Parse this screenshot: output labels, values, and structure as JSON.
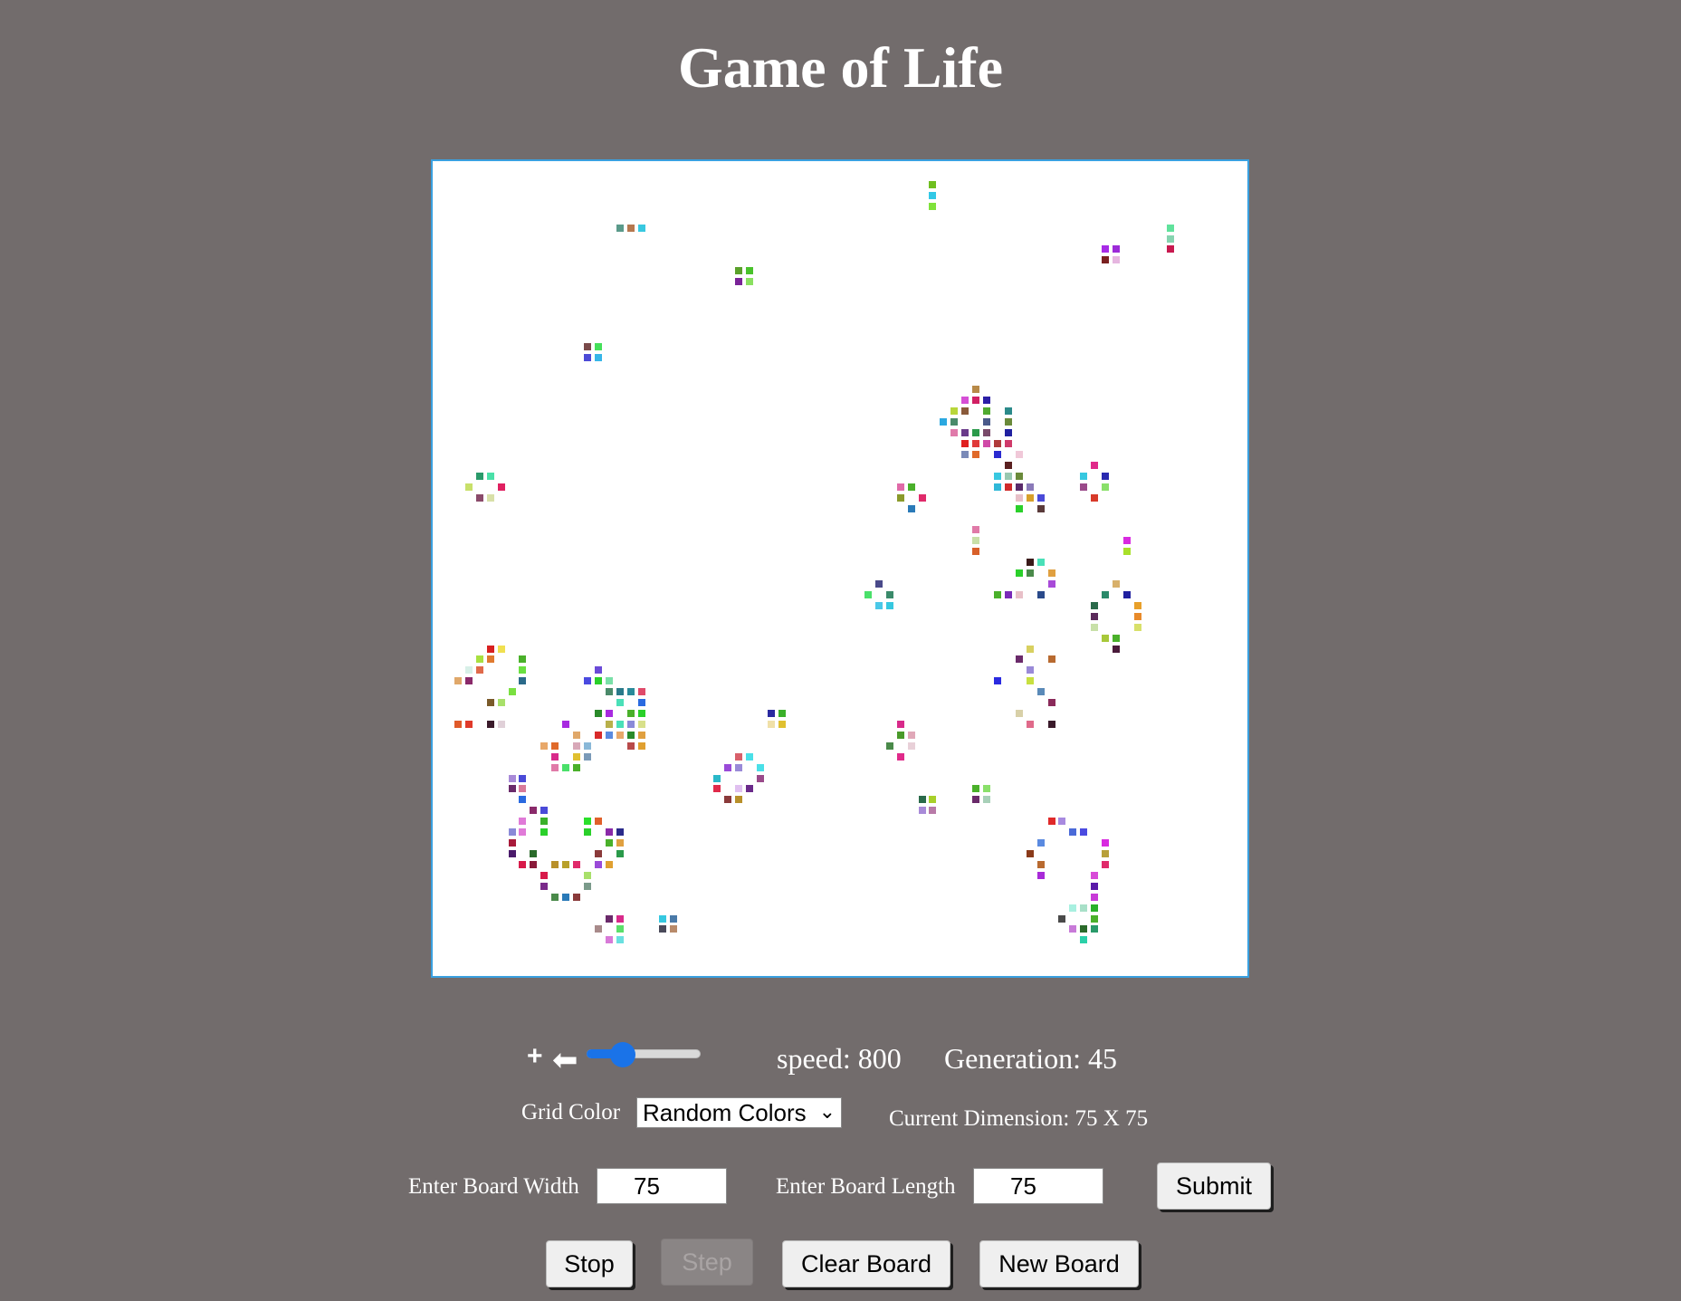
{
  "header": {
    "title": "Game of Life"
  },
  "board": {
    "columns": 75,
    "rows": 75,
    "live_cells": [
      [
        45,
        1,
        "#6fbf1f"
      ],
      [
        45,
        2,
        "#32c8e6"
      ],
      [
        45,
        3,
        "#7fe23a"
      ],
      [
        16,
        5,
        "#5a9a8a"
      ],
      [
        17,
        5,
        "#b5784f"
      ],
      [
        18,
        5,
        "#38c8e0"
      ],
      [
        67,
        5,
        "#60e29c"
      ],
      [
        67,
        6,
        "#86d4b0"
      ],
      [
        61,
        7,
        "#a72be6"
      ],
      [
        62,
        7,
        "#9c2bd8"
      ],
      [
        67,
        7,
        "#c8194f"
      ],
      [
        61,
        8,
        "#7a2020"
      ],
      [
        62,
        8,
        "#e6b6e0"
      ],
      [
        27,
        9,
        "#5aa12a"
      ],
      [
        28,
        9,
        "#49c22b"
      ],
      [
        27,
        10,
        "#7a2398"
      ],
      [
        28,
        10,
        "#8ae060"
      ],
      [
        13,
        16,
        "#7a4a4a"
      ],
      [
        14,
        16,
        "#45e05a"
      ],
      [
        13,
        17,
        "#4c4ad6"
      ],
      [
        14,
        17,
        "#36b6e8"
      ],
      [
        49,
        20,
        "#b88a48"
      ],
      [
        48,
        21,
        "#d64fd6"
      ],
      [
        49,
        21,
        "#d12063"
      ],
      [
        50,
        21,
        "#2b1fa6"
      ],
      [
        47,
        22,
        "#b8d63a"
      ],
      [
        48,
        22,
        "#8a5a3a"
      ],
      [
        50,
        22,
        "#50aa30"
      ],
      [
        52,
        22,
        "#2b8a8a"
      ],
      [
        46,
        23,
        "#2ba8e0"
      ],
      [
        47,
        23,
        "#4a8a6a"
      ],
      [
        50,
        23,
        "#4a5a8a"
      ],
      [
        52,
        23,
        "#6a8a3a"
      ],
      [
        47,
        24,
        "#e07aaa"
      ],
      [
        48,
        24,
        "#6a3a8a"
      ],
      [
        49,
        24,
        "#2a9a4a"
      ],
      [
        50,
        24,
        "#7a4a6a"
      ],
      [
        52,
        24,
        "#2020a0"
      ],
      [
        48,
        25,
        "#e02020"
      ],
      [
        49,
        25,
        "#e03a3a"
      ],
      [
        50,
        25,
        "#d04aa8"
      ],
      [
        51,
        25,
        "#b03a3a"
      ],
      [
        52,
        25,
        "#d03a6a"
      ],
      [
        48,
        26,
        "#7a8ab8"
      ],
      [
        49,
        26,
        "#e06a2a"
      ],
      [
        51,
        26,
        "#2a2ad0"
      ],
      [
        53,
        26,
        "#f0c8d8"
      ],
      [
        52,
        27,
        "#5a2020"
      ],
      [
        60,
        27,
        "#e02a8a"
      ],
      [
        3,
        28,
        "#2a9a6a"
      ],
      [
        4,
        28,
        "#4ae0a8"
      ],
      [
        51,
        28,
        "#38c8e0"
      ],
      [
        52,
        28,
        "#98c8b0"
      ],
      [
        53,
        28,
        "#6a8a3a"
      ],
      [
        59,
        28,
        "#36c8e0"
      ],
      [
        61,
        28,
        "#2a2ab0"
      ],
      [
        2,
        29,
        "#c8e06a"
      ],
      [
        5,
        29,
        "#e02060"
      ],
      [
        42,
        29,
        "#e06aa8"
      ],
      [
        43,
        29,
        "#4ab02a"
      ],
      [
        51,
        29,
        "#30b8d8"
      ],
      [
        52,
        29,
        "#d02a2a"
      ],
      [
        53,
        29,
        "#5a2a6a"
      ],
      [
        54,
        29,
        "#8a7ab8"
      ],
      [
        59,
        29,
        "#9a4a8a"
      ],
      [
        61,
        29,
        "#8ae06a"
      ],
      [
        3,
        30,
        "#8a4a6a"
      ],
      [
        4,
        30,
        "#d8e0a8"
      ],
      [
        42,
        30,
        "#8a9a2a"
      ],
      [
        44,
        30,
        "#e02a6a"
      ],
      [
        53,
        30,
        "#e8c0c8"
      ],
      [
        54,
        30,
        "#d8a02a"
      ],
      [
        55,
        30,
        "#4a4ad8"
      ],
      [
        60,
        30,
        "#d83a2a"
      ],
      [
        43,
        31,
        "#2a7ab8"
      ],
      [
        53,
        31,
        "#2ad02a"
      ],
      [
        55,
        31,
        "#5a3a3a"
      ],
      [
        49,
        33,
        "#e07aa8"
      ],
      [
        49,
        34,
        "#c8e0a8"
      ],
      [
        63,
        34,
        "#d82ae0"
      ],
      [
        49,
        35,
        "#d8602a"
      ],
      [
        63,
        35,
        "#a8e02a"
      ],
      [
        54,
        36,
        "#3a1a1a"
      ],
      [
        55,
        36,
        "#4ae0b8"
      ],
      [
        53,
        37,
        "#2ad02a"
      ],
      [
        54,
        37,
        "#4a8a4a"
      ],
      [
        56,
        37,
        "#e0a040"
      ],
      [
        40,
        38,
        "#4a4a8a"
      ],
      [
        56,
        38,
        "#a84ad8"
      ],
      [
        62,
        38,
        "#d8b06a"
      ],
      [
        39,
        39,
        "#4ae06a"
      ],
      [
        41,
        39,
        "#3a8a6a"
      ],
      [
        51,
        39,
        "#4ab02a"
      ],
      [
        52,
        39,
        "#7a2ab8"
      ],
      [
        53,
        39,
        "#e8c0c8"
      ],
      [
        55,
        39,
        "#2a4a8a"
      ],
      [
        61,
        39,
        "#2a8a6a"
      ],
      [
        63,
        39,
        "#2020a0"
      ],
      [
        40,
        40,
        "#4ac8e8"
      ],
      [
        41,
        40,
        "#36c8e0"
      ],
      [
        60,
        40,
        "#2a6a4a"
      ],
      [
        64,
        40,
        "#e8a02a"
      ],
      [
        60,
        41,
        "#5a2a5a"
      ],
      [
        64,
        41,
        "#e88a2a"
      ],
      [
        60,
        42,
        "#c8e0a8"
      ],
      [
        64,
        42,
        "#d8e06a"
      ],
      [
        61,
        43,
        "#a8c83a"
      ],
      [
        62,
        43,
        "#4ab02a"
      ],
      [
        62,
        44,
        "#4a1a3a"
      ],
      [
        4,
        44,
        "#d82020"
      ],
      [
        5,
        44,
        "#f0e050"
      ],
      [
        54,
        44,
        "#d8d060"
      ],
      [
        3,
        45,
        "#a8e040"
      ],
      [
        4,
        45,
        "#e07a30"
      ],
      [
        7,
        45,
        "#4ab02a"
      ],
      [
        53,
        45,
        "#6a2a6a"
      ],
      [
        56,
        45,
        "#b86a30"
      ],
      [
        2,
        46,
        "#d8f0e8"
      ],
      [
        3,
        46,
        "#e06a4a"
      ],
      [
        7,
        46,
        "#6ae040"
      ],
      [
        14,
        46,
        "#6a4ad8"
      ],
      [
        54,
        46,
        "#9a8ad8"
      ],
      [
        1,
        47,
        "#e0a86a"
      ],
      [
        2,
        47,
        "#8a2a6a"
      ],
      [
        7,
        47,
        "#2a6a8a"
      ],
      [
        13,
        47,
        "#4a4ae0"
      ],
      [
        14,
        47,
        "#2ad02a"
      ],
      [
        15,
        47,
        "#7ae0a8"
      ],
      [
        51,
        47,
        "#2a2ae0"
      ],
      [
        54,
        47,
        "#c8e040"
      ],
      [
        6,
        48,
        "#7ae040"
      ],
      [
        15,
        48,
        "#4a8a6a"
      ],
      [
        16,
        48,
        "#2a7a8a"
      ],
      [
        17,
        48,
        "#2a8a9a"
      ],
      [
        18,
        48,
        "#e04a6a"
      ],
      [
        55,
        48,
        "#5a8ab8"
      ],
      [
        4,
        49,
        "#7a5a2a"
      ],
      [
        5,
        49,
        "#a8e06a"
      ],
      [
        16,
        49,
        "#4ae0b8"
      ],
      [
        18,
        49,
        "#2a6ae0"
      ],
      [
        56,
        49,
        "#8a2a5a"
      ],
      [
        14,
        50,
        "#2a8a2a"
      ],
      [
        15,
        50,
        "#a82ae0"
      ],
      [
        17,
        50,
        "#4ab02a"
      ],
      [
        18,
        50,
        "#2ad02a"
      ],
      [
        30,
        50,
        "#2a2aa0"
      ],
      [
        31,
        50,
        "#3ab02a"
      ],
      [
        53,
        50,
        "#d8d0a8"
      ],
      [
        1,
        51,
        "#e05a2a"
      ],
      [
        2,
        51,
        "#e03a2a"
      ],
      [
        4,
        51,
        "#3a1a2a"
      ],
      [
        5,
        51,
        "#e0d0d8"
      ],
      [
        11,
        51,
        "#a82ae0"
      ],
      [
        15,
        51,
        "#b8b04a"
      ],
      [
        16,
        51,
        "#4ae0b8"
      ],
      [
        17,
        51,
        "#8a8ad8"
      ],
      [
        18,
        51,
        "#d8e08a"
      ],
      [
        30,
        51,
        "#f0e0a8"
      ],
      [
        31,
        51,
        "#e0c030"
      ],
      [
        42,
        51,
        "#d82a8a"
      ],
      [
        54,
        51,
        "#e06a8a"
      ],
      [
        56,
        51,
        "#3a1a2a"
      ],
      [
        12,
        52,
        "#e0a86a"
      ],
      [
        14,
        52,
        "#d82a2a"
      ],
      [
        15,
        52,
        "#5a8ae0"
      ],
      [
        16,
        52,
        "#e8a86a"
      ],
      [
        17,
        52,
        "#2a8a2a"
      ],
      [
        18,
        52,
        "#e0a040"
      ],
      [
        42,
        52,
        "#4a9a2a"
      ],
      [
        43,
        52,
        "#e0a8b8"
      ],
      [
        9,
        53,
        "#e8a86a"
      ],
      [
        10,
        53,
        "#e06a2a"
      ],
      [
        12,
        53,
        "#d8a8b8"
      ],
      [
        13,
        53,
        "#8ab8d8"
      ],
      [
        17,
        53,
        "#b84a4a"
      ],
      [
        18,
        53,
        "#e0a030"
      ],
      [
        41,
        53,
        "#4a8a4a"
      ],
      [
        43,
        53,
        "#e8d0d8"
      ],
      [
        10,
        54,
        "#d82a8a"
      ],
      [
        12,
        54,
        "#e0c030"
      ],
      [
        13,
        54,
        "#7a9ab8"
      ],
      [
        42,
        54,
        "#e02a8a"
      ],
      [
        27,
        54,
        "#d8606a"
      ],
      [
        28,
        54,
        "#4ae0e8"
      ],
      [
        10,
        55,
        "#e07aa8"
      ],
      [
        11,
        55,
        "#4ae06a"
      ],
      [
        12,
        55,
        "#4ab02a"
      ],
      [
        26,
        55,
        "#9a4ad8"
      ],
      [
        27,
        55,
        "#9a8ad8"
      ],
      [
        29,
        55,
        "#4ae0e8"
      ],
      [
        6,
        56,
        "#a88ad8"
      ],
      [
        7,
        56,
        "#4a4ad8"
      ],
      [
        25,
        56,
        "#2ab8c8"
      ],
      [
        29,
        56,
        "#9a4a8a"
      ],
      [
        6,
        57,
        "#6a2a6a"
      ],
      [
        7,
        57,
        "#d87a9a"
      ],
      [
        25,
        57,
        "#e02a4a"
      ],
      [
        27,
        57,
        "#e0c0f0"
      ],
      [
        28,
        57,
        "#6a2a8a"
      ],
      [
        7,
        58,
        "#2a6ae0"
      ],
      [
        26,
        58,
        "#8a3a3a"
      ],
      [
        27,
        58,
        "#b8902a"
      ],
      [
        44,
        58,
        "#2a6a4a"
      ],
      [
        45,
        58,
        "#a8d02a"
      ],
      [
        49,
        57,
        "#4ab02a"
      ],
      [
        50,
        57,
        "#8ae06a"
      ],
      [
        49,
        58,
        "#6a2a6a"
      ],
      [
        50,
        58,
        "#a8d0b8"
      ],
      [
        8,
        59,
        "#8a2a6a"
      ],
      [
        9,
        59,
        "#4a4ad8"
      ],
      [
        44,
        59,
        "#a88ad8"
      ],
      [
        45,
        59,
        "#b87aa8"
      ],
      [
        7,
        60,
        "#e07ad8"
      ],
      [
        9,
        60,
        "#3ab02a"
      ],
      [
        13,
        60,
        "#2ae02a"
      ],
      [
        14,
        60,
        "#e0602a"
      ],
      [
        56,
        60,
        "#e02a2a"
      ],
      [
        57,
        60,
        "#a88ae0"
      ],
      [
        6,
        61,
        "#8a8ad8"
      ],
      [
        7,
        61,
        "#e07ad8"
      ],
      [
        9,
        61,
        "#2ad02a"
      ],
      [
        13,
        61,
        "#2ad02a"
      ],
      [
        15,
        61,
        "#8a2aa8"
      ],
      [
        16,
        61,
        "#2a2a8a"
      ],
      [
        58,
        61,
        "#4a6ad8"
      ],
      [
        59,
        61,
        "#4a4ae0"
      ],
      [
        6,
        62,
        "#a81a3a"
      ],
      [
        15,
        62,
        "#4ab02a"
      ],
      [
        16,
        62,
        "#e0a040"
      ],
      [
        55,
        62,
        "#5a8ae0"
      ],
      [
        61,
        62,
        "#d82ae0"
      ],
      [
        6,
        63,
        "#4a1a6a"
      ],
      [
        8,
        63,
        "#2a6a2a"
      ],
      [
        14,
        63,
        "#8a3a3a"
      ],
      [
        16,
        63,
        "#2a9a4a"
      ],
      [
        54,
        63,
        "#8a3a1a"
      ],
      [
        61,
        63,
        "#b8a03a"
      ],
      [
        7,
        64,
        "#d81a4a"
      ],
      [
        8,
        64,
        "#8a1a3a"
      ],
      [
        10,
        64,
        "#b8902a"
      ],
      [
        11,
        64,
        "#b8a02a"
      ],
      [
        12,
        64,
        "#e02a6a"
      ],
      [
        14,
        64,
        "#9a4ad8"
      ],
      [
        15,
        64,
        "#e0a030"
      ],
      [
        55,
        64,
        "#b86a30"
      ],
      [
        61,
        64,
        "#e02a6a"
      ],
      [
        9,
        65,
        "#d81a4a"
      ],
      [
        13,
        65,
        "#a8e06a"
      ],
      [
        55,
        65,
        "#a82ad8"
      ],
      [
        60,
        65,
        "#d84ad8"
      ],
      [
        9,
        66,
        "#7a2a8a"
      ],
      [
        13,
        66,
        "#7a9a8a"
      ],
      [
        60,
        66,
        "#5a1aa8"
      ],
      [
        10,
        67,
        "#4a8a4a"
      ],
      [
        11,
        67,
        "#2a7ab8"
      ],
      [
        12,
        67,
        "#8a3a3a"
      ],
      [
        60,
        67,
        "#c83ad8"
      ],
      [
        58,
        68,
        "#a8f0e0"
      ],
      [
        59,
        68,
        "#a8e0c8"
      ],
      [
        60,
        68,
        "#2ab02a"
      ],
      [
        15,
        69,
        "#6a2a6a"
      ],
      [
        16,
        69,
        "#d82a8a"
      ],
      [
        20,
        69,
        "#36c8e0"
      ],
      [
        21,
        69,
        "#4a7aa8"
      ],
      [
        57,
        69,
        "#4a4a4a"
      ],
      [
        60,
        69,
        "#4ab02a"
      ],
      [
        14,
        70,
        "#a88a8a"
      ],
      [
        16,
        70,
        "#5ae06a"
      ],
      [
        20,
        70,
        "#4a4a5a"
      ],
      [
        21,
        70,
        "#b88a6a"
      ],
      [
        58,
        70,
        "#c87ad8"
      ],
      [
        59,
        70,
        "#2a6a2a"
      ],
      [
        60,
        70,
        "#2a9a6a"
      ],
      [
        15,
        71,
        "#d87ad8"
      ],
      [
        16,
        71,
        "#6ae0e0"
      ],
      [
        59,
        71,
        "#2ad0a8"
      ]
    ]
  },
  "controls": {
    "zoom_glyph": "+",
    "arrow_glyph": "⬅",
    "slider_value": 0.27,
    "speed_text": "speed: 800",
    "generation_text": "Generation: 45",
    "grid_color_label": "Grid Color",
    "grid_color_selected": "Random Colors",
    "dimension_text": "Current Dimension: 75 X 75",
    "width_label": "Enter Board Width",
    "width_value": "75",
    "length_label": "Enter Board Length",
    "length_value": "75",
    "submit_label": "Submit"
  },
  "actions": {
    "stop_label": "Stop",
    "step_label": "Step",
    "clear_label": "Clear Board",
    "new_label": "New Board"
  },
  "colors": {
    "background": "#726c6c",
    "board_border": "#3aa0e0",
    "slider_accent": "#1a73e8"
  }
}
